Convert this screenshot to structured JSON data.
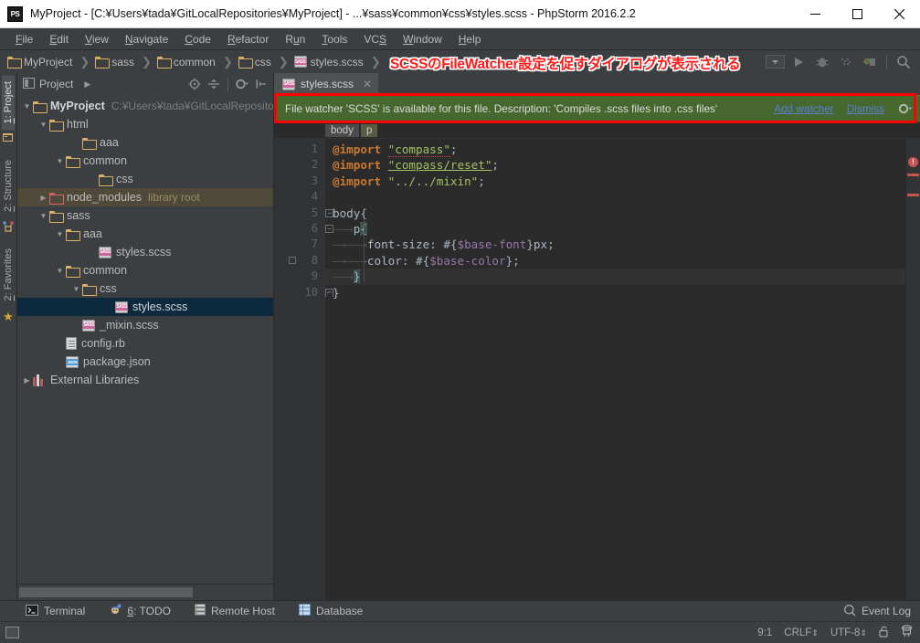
{
  "window": {
    "title": "MyProject - [C:¥Users¥tada¥GitLocalRepositories¥MyProject] - ...¥sass¥common¥css¥styles.scss - PhpStorm 2016.2.2",
    "logo_text": "PS",
    "minimize": "—",
    "maximize": "□",
    "close": "✕"
  },
  "menu": {
    "items": [
      {
        "label": "File",
        "accel": "F"
      },
      {
        "label": "Edit",
        "accel": "E"
      },
      {
        "label": "View",
        "accel": "V"
      },
      {
        "label": "Navigate",
        "accel": "N"
      },
      {
        "label": "Code",
        "accel": "C"
      },
      {
        "label": "Refactor",
        "accel": "R"
      },
      {
        "label": "Run",
        "accel": "u"
      },
      {
        "label": "Tools",
        "accel": "T"
      },
      {
        "label": "VCS",
        "accel": "S"
      },
      {
        "label": "Window",
        "accel": "W"
      },
      {
        "label": "Help",
        "accel": "H"
      }
    ]
  },
  "breadcrumb": {
    "items": [
      {
        "label": "MyProject",
        "icon": "folder-icon"
      },
      {
        "label": "sass",
        "icon": "folder-icon"
      },
      {
        "label": "common",
        "icon": "folder-icon"
      },
      {
        "label": "css",
        "icon": "folder-icon"
      },
      {
        "label": "styles.scss",
        "icon": "sass-file-icon"
      }
    ],
    "separator": "❯"
  },
  "toolbar_right": {
    "icons": [
      "run-configuration-dropdown",
      "run-icon",
      "debug-icon",
      "coverage-icon",
      "stop-icon",
      "search-everywhere-icon"
    ]
  },
  "tool_strip": {
    "tabs": [
      {
        "label": "1: Project",
        "accel": "1",
        "active": true,
        "icon": "project-icon"
      },
      {
        "label": "2: Structure",
        "accel": "2",
        "active": false,
        "icon": "structure-icon"
      },
      {
        "label": "2: Favorites",
        "accel": "2",
        "active": false,
        "icon": "star-icon"
      }
    ]
  },
  "project_panel": {
    "title": "Project",
    "expand_arrow": "▶",
    "tool_icons": [
      "locate-icon",
      "collapse-all-icon",
      "settings-gear-icon",
      "hide-panel-icon"
    ],
    "tree": [
      {
        "indent": 0,
        "twisty": "▼",
        "icon": "folder-icon",
        "label": "MyProject",
        "sub": "C:¥Users¥tada¥GitLocalRepositor",
        "state": "normal"
      },
      {
        "indent": 1,
        "twisty": "▼",
        "icon": "folder-icon",
        "label": "html",
        "sub": "",
        "state": "normal"
      },
      {
        "indent": 2,
        "twisty": "",
        "icon": "folder-icon",
        "label": "aaa",
        "sub": "",
        "state": "normal"
      },
      {
        "indent": 2,
        "twisty": "▼",
        "icon": "folder-icon",
        "label": "common",
        "sub": "",
        "state": "normal"
      },
      {
        "indent": 3,
        "twisty": "",
        "icon": "folder-icon",
        "label": "css",
        "sub": "",
        "state": "normal"
      },
      {
        "indent": 1,
        "twisty": "▶",
        "icon": "folder-red-icon",
        "label": "node_modules",
        "sub": "library root",
        "state": "highlight"
      },
      {
        "indent": 1,
        "twisty": "▼",
        "icon": "folder-icon",
        "label": "sass",
        "sub": "",
        "state": "normal"
      },
      {
        "indent": 2,
        "twisty": "▼",
        "icon": "folder-icon",
        "label": "aaa",
        "sub": "",
        "state": "normal"
      },
      {
        "indent": 3,
        "twisty": "",
        "icon": "sass-file-icon",
        "label": "styles.scss",
        "sub": "",
        "state": "normal"
      },
      {
        "indent": 2,
        "twisty": "▼",
        "icon": "folder-icon",
        "label": "common",
        "sub": "",
        "state": "normal"
      },
      {
        "indent": 3,
        "twisty": "▼",
        "icon": "folder-icon",
        "label": "css",
        "sub": "",
        "state": "normal"
      },
      {
        "indent": 4,
        "twisty": "",
        "icon": "sass-file-icon",
        "label": "styles.scss",
        "sub": "",
        "state": "selected"
      },
      {
        "indent": 2,
        "twisty": "",
        "icon": "sass-file-icon",
        "label": "_mixin.scss",
        "sub": "",
        "state": "normal"
      },
      {
        "indent": 1,
        "twisty": "",
        "icon": "ruby-file-icon",
        "label": "config.rb",
        "sub": "",
        "state": "normal"
      },
      {
        "indent": 1,
        "twisty": "",
        "icon": "json-file-icon",
        "label": "package.json",
        "sub": "",
        "state": "normal"
      },
      {
        "indent": 0,
        "twisty": "▶",
        "icon": "library-icon",
        "label": "External Libraries",
        "sub": "",
        "state": "normal"
      }
    ]
  },
  "editor": {
    "tabs": [
      {
        "label": "styles.scss",
        "icon": "sass-file-icon",
        "close": "✕",
        "active": true
      }
    ],
    "structure_crumbs": [
      {
        "label": "body"
      },
      {
        "label": "p"
      }
    ],
    "lines": [
      {
        "n": "1",
        "fold": "minus-none"
      },
      {
        "n": "2",
        "fold": ""
      },
      {
        "n": "3",
        "fold": ""
      },
      {
        "n": "4",
        "fold": ""
      },
      {
        "n": "5",
        "fold": "−"
      },
      {
        "n": "6",
        "fold": "−"
      },
      {
        "n": "7",
        "fold": ""
      },
      {
        "n": "8",
        "fold": ""
      },
      {
        "n": "9",
        "fold": "⌐"
      },
      {
        "n": "10",
        "fold": "⌐"
      }
    ],
    "code_text": [
      "@import \"compass\";",
      "@import \"compass/reset\";",
      "@import \"../../mixin\";",
      "",
      "body{",
      "    p{",
      "        font-size: #{$base-font}px;",
      "        color: #{$base-color};",
      "    }",
      "}"
    ],
    "current_line": 9
  },
  "notification": {
    "message": "File watcher 'SCSS' is available for this file. Description: 'Compiles .scss files into .css files'",
    "add_watcher": "Add watcher",
    "dismiss": "Dismiss",
    "gear_icon": "settings-gear-icon",
    "bg_color": "#46682e"
  },
  "annotation": {
    "text": "SCSSのFileWatcher設定を促すダイアログが表示される",
    "color": "#ff1a1a",
    "box_color": "#ff0000"
  },
  "tool_windows": {
    "items": [
      {
        "label": "Terminal",
        "accel": "",
        "icon": "terminal-icon"
      },
      {
        "label": "6: TODO",
        "accel": "6",
        "icon": "todo-icon"
      },
      {
        "label": "Remote Host",
        "accel": "",
        "icon": "remote-host-icon"
      },
      {
        "label": "Database",
        "accel": "",
        "icon": "database-icon"
      }
    ],
    "event_log": "Event Log",
    "event_log_icon": "event-log-icon"
  },
  "status_bar": {
    "caret": "9:1",
    "line_separator": "CRLF",
    "encoding": "UTF-8",
    "lock_icon": "unlocked-icon",
    "inspection_icon": "hector-icon",
    "spinner_arrows": "⇕"
  }
}
